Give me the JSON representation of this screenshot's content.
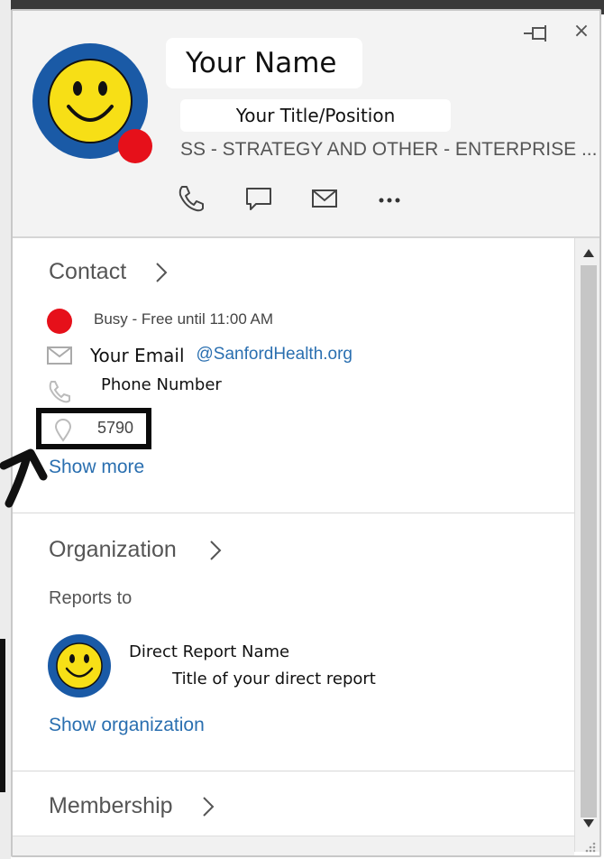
{
  "window": {
    "pin_icon": "pin-icon",
    "close_icon": "close-icon",
    "close_glyph": "×"
  },
  "profile": {
    "name": "Your Name",
    "title": "Your Title/Position",
    "department": "SS - STRATEGY AND OTHER - ENTERPRISE ...",
    "presence_color": "#e6101a",
    "avatar": "smiley-face"
  },
  "actions": [
    {
      "icon": "phone-icon"
    },
    {
      "icon": "chat-icon"
    },
    {
      "icon": "mail-icon"
    },
    {
      "icon": "more-icon"
    }
  ],
  "contact": {
    "heading": "Contact",
    "presence_text": "Busy - Free until 11:00 AM",
    "email_label": "Your Email",
    "email_tail": "s@SanfordHealth.org",
    "phone": "Phone Number",
    "office": "5790",
    "show_more": "Show more"
  },
  "organization": {
    "heading": "Organization",
    "reports_to_label": "Reports to",
    "direct_report_name": "Direct Report Name",
    "direct_report_title": "Title of your direct report",
    "show_organization": "Show organization"
  },
  "membership": {
    "heading": "Membership"
  },
  "colors": {
    "link": "#2a6fb0",
    "busy": "#e6101a",
    "avatar_ring": "#1a5aa6",
    "avatar_face": "#f7df16"
  }
}
